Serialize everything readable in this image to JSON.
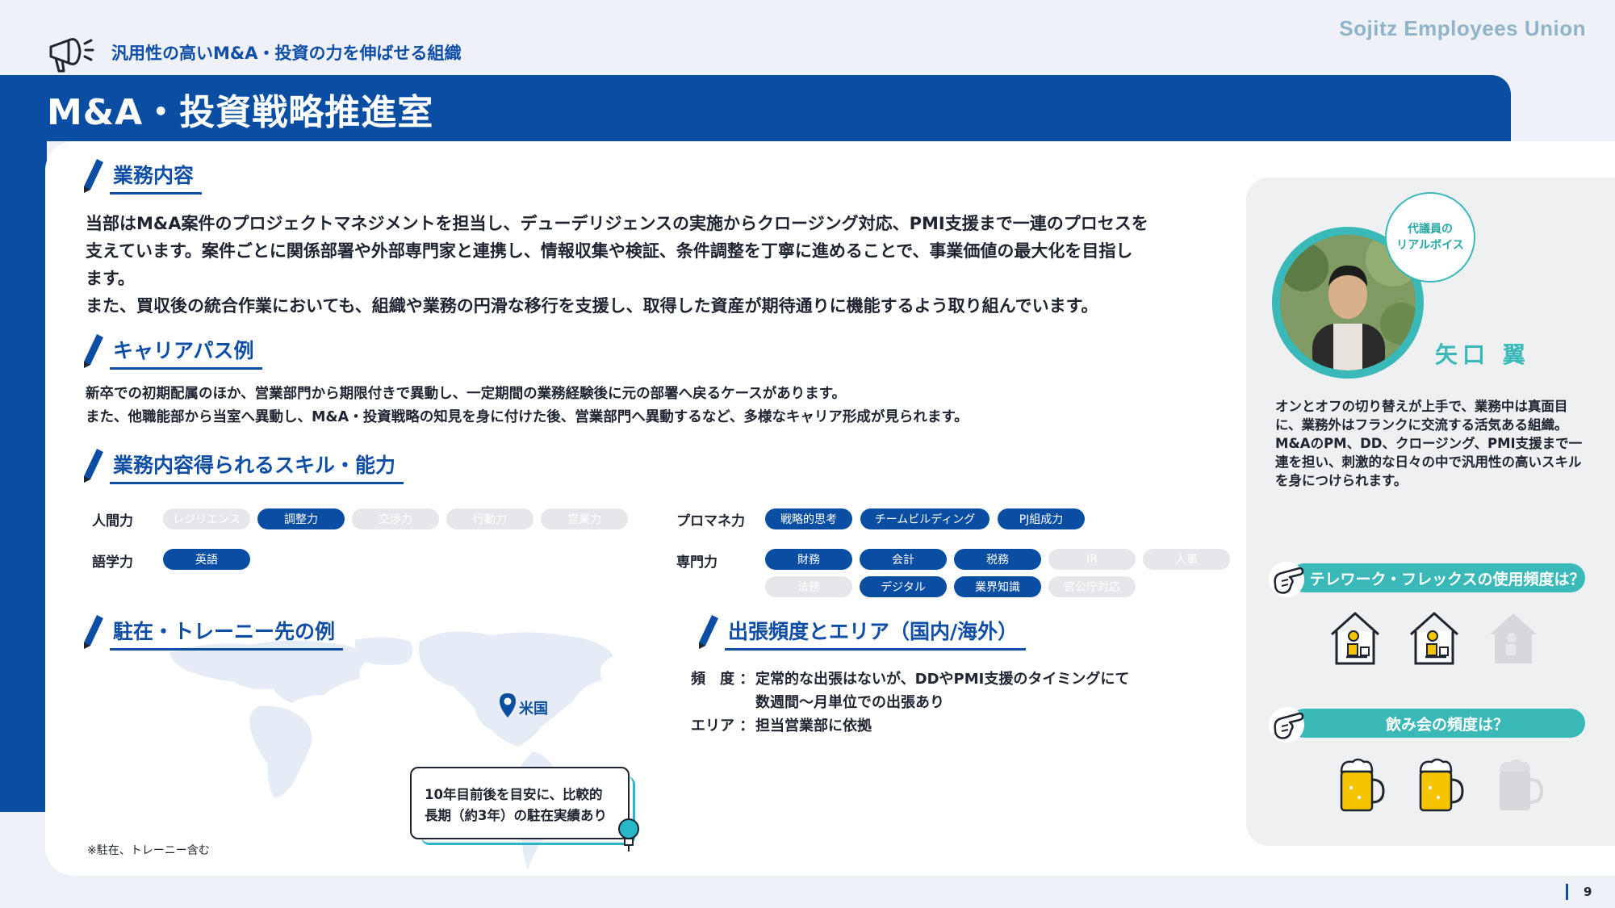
{
  "brand": {
    "logo": "Sojitz Employees Union"
  },
  "header": {
    "caption": "汎用性の高いM&A・投資の力を伸ばせる組織",
    "title": "M&A・投資戦略推進室"
  },
  "sections": {
    "duties": {
      "title": "業務内容",
      "paragraph1": "当部はM&A案件のプロジェクトマネジメントを担当し、デューデリジェンスの実施からクロージング対応、PMI支援まで一連のプロセスを",
      "paragraph2": "支えています。案件ごとに関係部署や外部専門家と連携し、情報収集や検証、条件調整を丁寧に進めることで、事業価値の最大化を目指し",
      "paragraph3": "ます。",
      "paragraph4": "また、買収後の統合作業においても、組織や業務の円滑な移行を支援し、取得した資産が期待通りに機能するよう取り組んでいます。"
    },
    "career": {
      "title": "キャリアパス例",
      "line1": "新卒での初期配属のほか、営業部門から期限付きで異動し、一定期間の業務経験後に元の部署へ戻るケースがあります。",
      "line2": "また、他職能部から当室へ異動し、M&A・投資戦略の知見を身に付けた後、営業部門へ異動するなど、多様なキャリア形成が見られます。"
    },
    "skills": {
      "title": "業務内容得られるスキル・能力",
      "groups": [
        {
          "label": "人間力",
          "pills": [
            {
              "text": "レジリエンス",
              "active": false
            },
            {
              "text": "調整力",
              "active": true
            },
            {
              "text": "交渉力",
              "active": false
            },
            {
              "text": "行動力",
              "active": false
            },
            {
              "text": "営業力",
              "active": false
            }
          ]
        },
        {
          "label": "語学力",
          "pills": [
            {
              "text": "英語",
              "active": true
            }
          ]
        },
        {
          "label": "プロマネ力",
          "pills": [
            {
              "text": "戦略的思考",
              "active": true
            },
            {
              "text": "チームビルディング",
              "active": true
            },
            {
              "text": "PJ組成力",
              "active": true
            }
          ]
        },
        {
          "label": "専門力",
          "pills": [
            {
              "text": "財務",
              "active": true
            },
            {
              "text": "会計",
              "active": true
            },
            {
              "text": "税務",
              "active": true
            },
            {
              "text": "IR",
              "active": false
            },
            {
              "text": "人事",
              "active": false
            },
            {
              "text": "法務",
              "active": false
            },
            {
              "text": "デジタル",
              "active": true
            },
            {
              "text": "業界知識",
              "active": true
            },
            {
              "text": "官公庁対応",
              "active": false
            }
          ]
        }
      ]
    },
    "posting": {
      "title": "駐在・トレーニー先の例",
      "location": "米国",
      "callout_line1": "10年目前後を目安に、比較的",
      "callout_line2": "長期（約3年）の駐在実績あり",
      "footnote": "※駐在、トレーニー含む"
    },
    "trips": {
      "title": "出張頻度とエリア（国内/海外）",
      "freq_key": "頻　度 ：",
      "freq_value1": "定常的な出張はないが、DDやPMI支援のタイミングにて",
      "freq_value2": "数週間～月単位での出張あり",
      "area_key": "エリア ：",
      "area_value": "担当営業部に依拠"
    }
  },
  "representative": {
    "bubble_line1": "代議員の",
    "bubble_line2": "リアルボイス",
    "name": "矢口 翼",
    "description": "オンとオフの切り替えが上手で、業務中は真面目に、業務外はフランクに交流する活気ある組織。M&AのPM、DD、クロージング、PMI支援まで一連を担い、刺激的な日々の中で汎用性の高いスキルを身につけられます。"
  },
  "questions": {
    "telework": {
      "label": "テレワーク・フレックスの使用頻度は？",
      "level": 2,
      "max": 3
    },
    "drinking": {
      "label": "飲み会の頻度は？",
      "level": 2,
      "max": 3
    }
  },
  "colors": {
    "navy": "#0a4ea3",
    "teal": "#3bb9b8",
    "inactive": "#e5e7eb"
  },
  "page_number": "9"
}
